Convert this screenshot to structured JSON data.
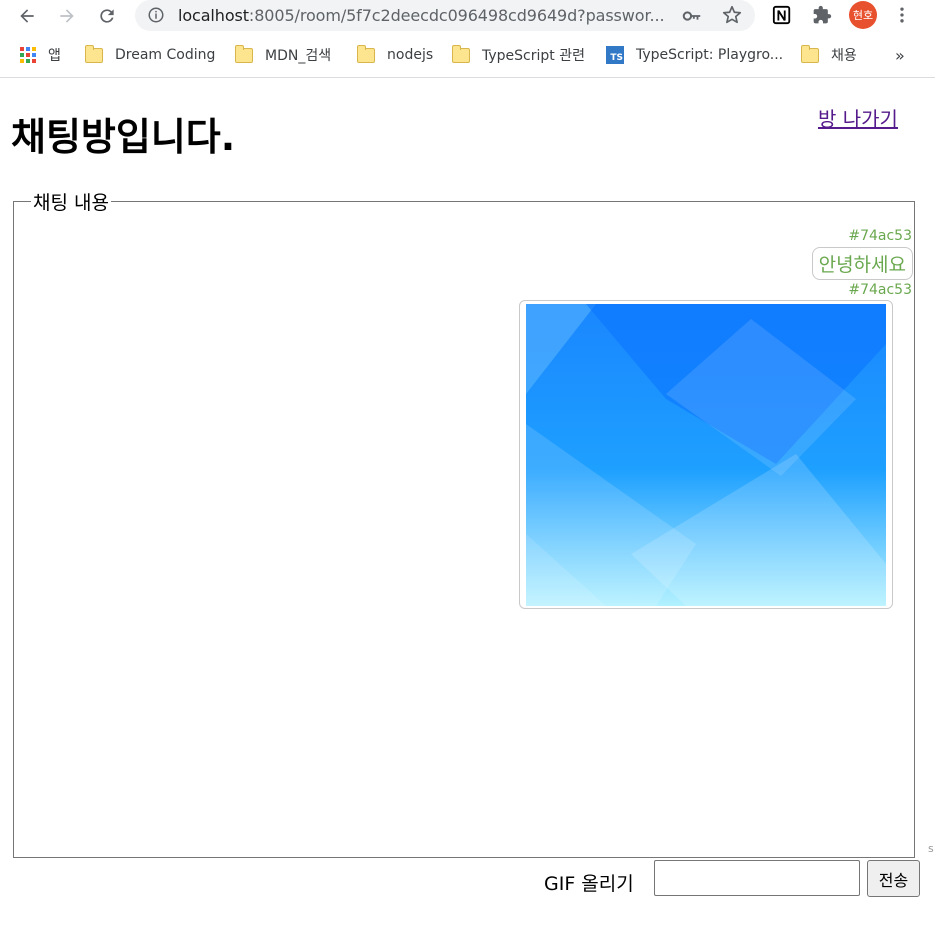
{
  "browser": {
    "url_host": "localhost",
    "url_rest": ":8005/room/5f7c2deecdc096498cd9649d?passwor...",
    "profile_initials": "현호",
    "bookmarks": [
      {
        "label": "앱",
        "icon": "apps-grid-icon"
      },
      {
        "label": "Dream Coding",
        "icon": "folder-icon"
      },
      {
        "label": "MDN_검색",
        "icon": "folder-icon"
      },
      {
        "label": "nodejs",
        "icon": "folder-icon"
      },
      {
        "label": "TypeScript 관련",
        "icon": "folder-icon"
      },
      {
        "label": "TypeScript: Playgro...",
        "icon": "typescript-icon"
      },
      {
        "label": "채용",
        "icon": "folder-icon"
      }
    ],
    "bookmark_overflow": "»",
    "ts_badge": "TS"
  },
  "page": {
    "title": "채팅방입니다.",
    "leave_link": "방 나가기",
    "chat_legend": "채팅 내용",
    "messages": [
      {
        "user": "#74ac53",
        "text": "안녕하세요"
      },
      {
        "user": "#74ac53",
        "type": "gif"
      }
    ],
    "user_color": "#74ac53",
    "gif_upload_label": "GIF 올리기",
    "send_button": "전송",
    "scroll_hint": "s"
  }
}
